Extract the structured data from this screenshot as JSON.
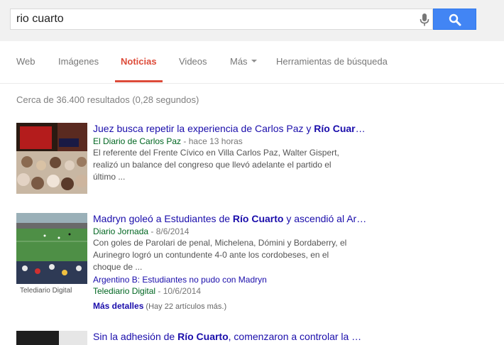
{
  "search": {
    "query": "rio cuarto"
  },
  "tabs": [
    {
      "label": "Web"
    },
    {
      "label": "Imágenes"
    },
    {
      "label": "Noticias"
    },
    {
      "label": "Videos"
    },
    {
      "label": "Más"
    },
    {
      "label": "Herramientas de búsqueda"
    }
  ],
  "stats": "Cerca de 36.400 resultados (0,28 segundos)",
  "results": [
    {
      "title_pre": "Juez busca repetir la experiencia de Carlos Paz y ",
      "title_bold": "Río Cuar",
      "title_post": "…",
      "source": "El Diario de Carlos Paz",
      "date": " - hace 13 horas",
      "snippet_lines": [
        "El referente del Frente Cívico en Villa Carlos Paz, Walter Gispert,",
        "realizó un balance del congreso que llevó adelante el partido el",
        "último ..."
      ]
    },
    {
      "title_pre": "Madryn goleó a Estudiantes de ",
      "title_bold": "Río Cuarto",
      "title_post": " y ascendió al Ar…",
      "source": "Diario Jornada",
      "date": " - 8/6/2014",
      "snippet_lines": [
        "Con goles de Parolari de penal, Michelena, Dómini y Bordaberry, el",
        "Aurinegro logró un contundente 4-0 ante los cordobeses, en el",
        "choque de ..."
      ],
      "image_caption": "Telediario Digital",
      "sub_title": "Argentino B: Estudiantes no pudo con Madryn",
      "sub_source": "Telediario Digital",
      "sub_date": " - 10/6/2014",
      "more_label": "Más detalles",
      "more_count": " (Hay 22 artículos más.)"
    },
    {
      "title_pre": "Sin la adhesión de ",
      "title_bold": "Río Cuarto",
      "title_post": ", comenzaron a controlar la …"
    }
  ],
  "colors": {
    "accent": "#dd4b39",
    "link": "#1a0dab",
    "source": "#006621",
    "button": "#4285f4"
  },
  "icons": [
    "microphone-icon",
    "search-icon"
  ]
}
